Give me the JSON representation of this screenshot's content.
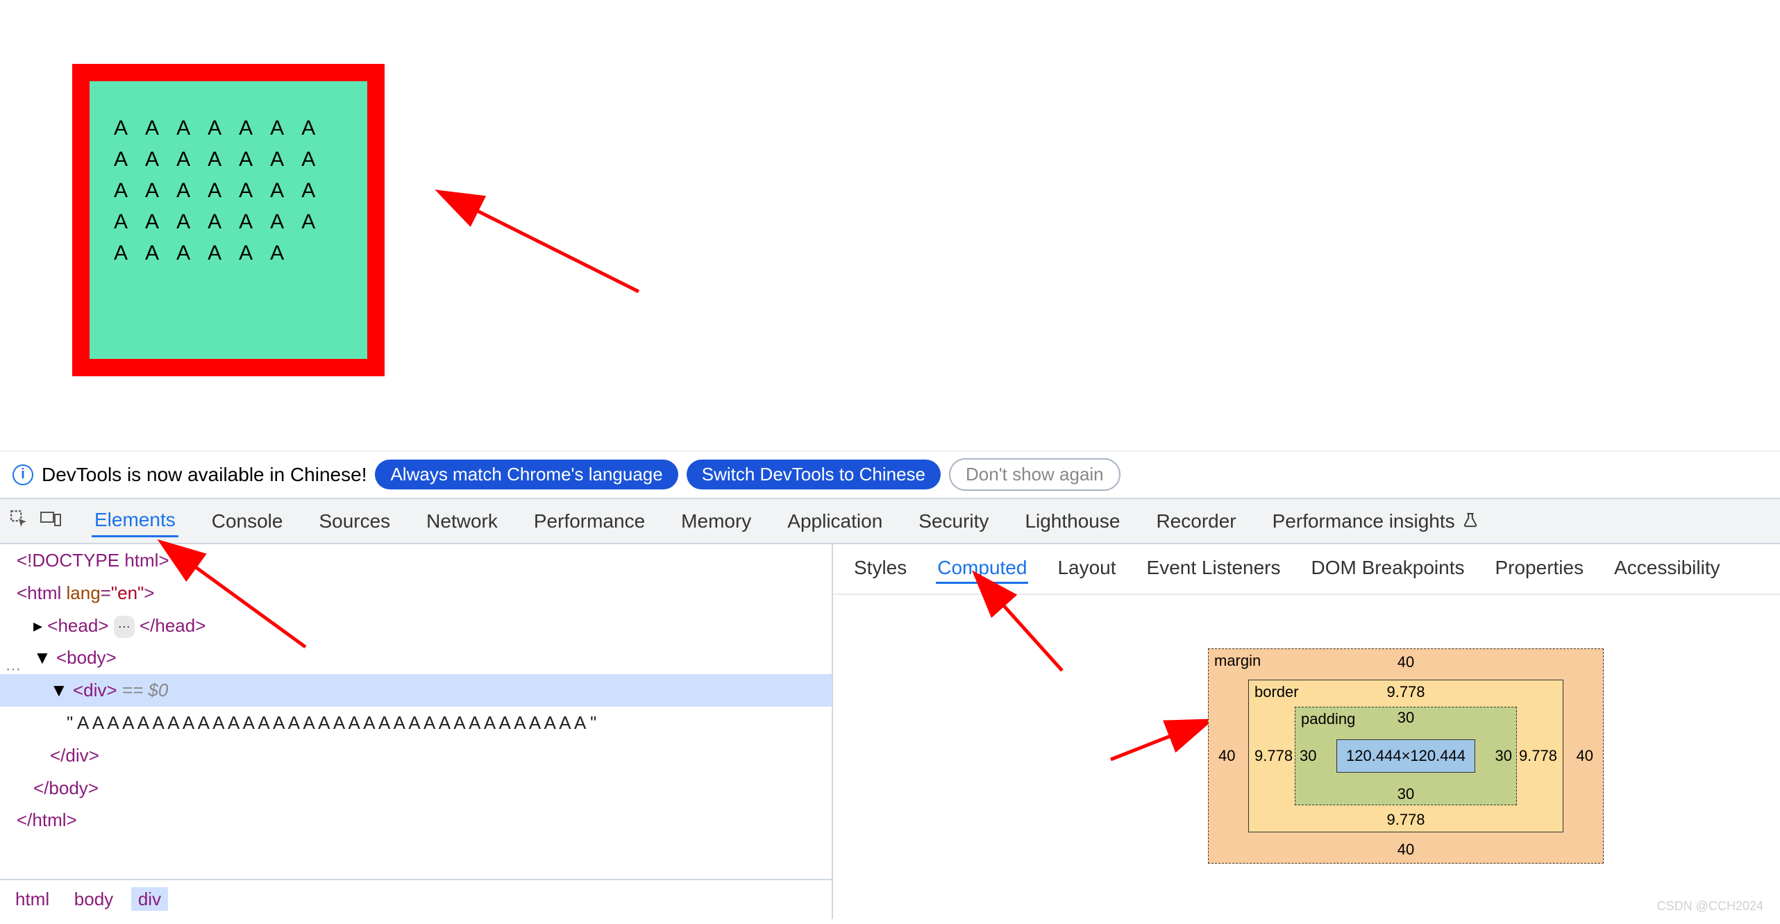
{
  "viewport": {
    "box_text": "A A A A A A A A A A A A A A A A A A A A A A A A A A A A A A A A A A"
  },
  "banner": {
    "message": "DevTools is now available in Chinese!",
    "btn_always": "Always match Chrome's language",
    "btn_switch": "Switch DevTools to Chinese",
    "btn_dismiss": "Don't show again"
  },
  "main_tabs": {
    "elements": "Elements",
    "console": "Console",
    "sources": "Sources",
    "network": "Network",
    "performance": "Performance",
    "memory": "Memory",
    "application": "Application",
    "security": "Security",
    "lighthouse": "Lighthouse",
    "recorder": "Recorder",
    "perf_insights": "Performance insights"
  },
  "dom": {
    "doctype": "<!DOCTYPE html>",
    "html_open": "<html lang=\"en\">",
    "head": "<head>",
    "head_close": "</head>",
    "body_open": "<body>",
    "div_open": "<div>",
    "eq0": " == $0",
    "text_node": "\" A A A A A A A A A A A A A A A A A A A A A A A A A A A A A A A A A A \"",
    "div_close": "</div>",
    "body_close": "</body>",
    "html_close": "</html>"
  },
  "breadcrumb": {
    "html": "html",
    "body": "body",
    "div": "div"
  },
  "sub_tabs": {
    "styles": "Styles",
    "computed": "Computed",
    "layout": "Layout",
    "event_listeners": "Event Listeners",
    "dom_breakpoints": "DOM Breakpoints",
    "properties": "Properties",
    "accessibility": "Accessibility"
  },
  "boxmodel": {
    "margin_label": "margin",
    "border_label": "border",
    "padding_label": "padding",
    "margin": {
      "top": "40",
      "right": "40",
      "bottom": "40",
      "left": "40"
    },
    "border": {
      "top": "9.778",
      "right": "9.778",
      "bottom": "9.778",
      "left": "9.778"
    },
    "padding": {
      "top": "30",
      "right": "30",
      "bottom": "30",
      "left": "30"
    },
    "content": "120.444×120.444"
  },
  "watermark": "CSDN @CCH2024"
}
